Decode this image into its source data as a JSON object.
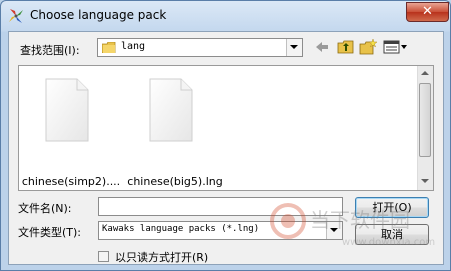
{
  "window": {
    "title": "Choose language pack",
    "close_symbol": "✕",
    "app_icon": "colorful-pinwheel-icon"
  },
  "lookin": {
    "label": "查找范围(I):",
    "value": "lang",
    "icon": "folder-icon"
  },
  "toolbar": {
    "back_icon": "back-arrow-icon",
    "up_icon": "up-folder-icon",
    "new_folder_icon": "new-folder-icon",
    "view_menu_icon": "view-menu-icon"
  },
  "files": [
    {
      "label": "chinese(simp2)....",
      "icon": "document-icon"
    },
    {
      "label": "chinese(big5).lng",
      "icon": "document-icon"
    }
  ],
  "filename": {
    "label": "文件名(N):",
    "value": ""
  },
  "filetype": {
    "label": "文件类型(T):",
    "value": "Kawaks language packs (*.lng)"
  },
  "readonly": {
    "label": "以只读方式打开(R)",
    "checked": false
  },
  "buttons": {
    "open": "打开(O)",
    "cancel": "取消"
  },
  "watermark": {
    "text": "当下软件园",
    "url_text": "www.downxia.com"
  },
  "colors": {
    "title_bar": "#c4d8ee",
    "close_button": "#c94f37",
    "default_button_border": "#3c7fb1"
  }
}
